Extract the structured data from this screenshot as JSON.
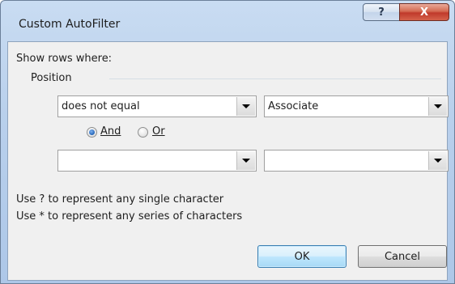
{
  "window": {
    "title": "Custom AutoFilter",
    "help_glyph": "?",
    "close_glyph": "X"
  },
  "dialog": {
    "show_rows_label": "Show rows where:",
    "group_label": "Position",
    "condition1": {
      "operator": "does not equal",
      "value": "Associate"
    },
    "logic": {
      "and_label": "And",
      "or_label": "Or",
      "selected": "And"
    },
    "condition2": {
      "operator": "",
      "value": ""
    },
    "hint1": "Use ? to represent any single character",
    "hint2": "Use * to represent any series of characters"
  },
  "buttons": {
    "ok": "OK",
    "cancel": "Cancel"
  },
  "icons": {
    "help": "help-icon",
    "close": "close-icon",
    "dropdown": "chevron-down-icon"
  }
}
